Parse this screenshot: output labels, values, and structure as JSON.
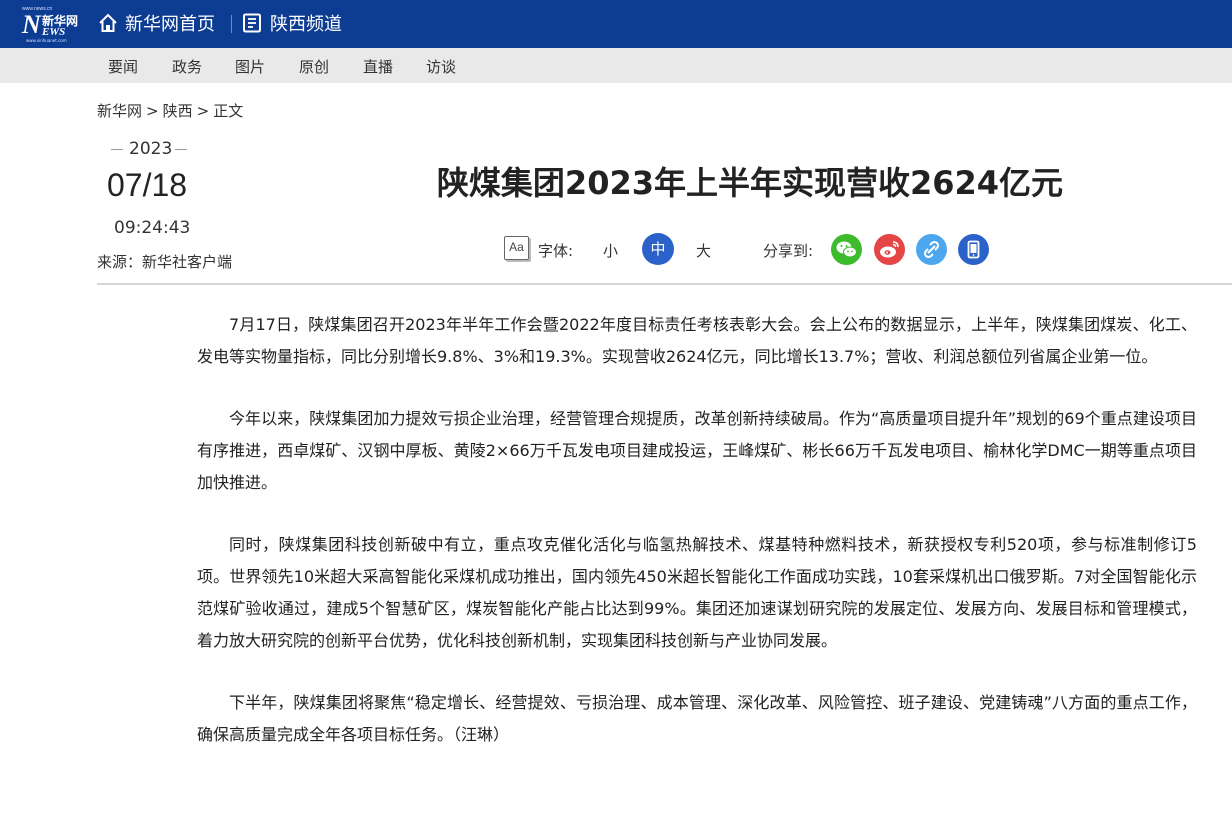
{
  "header": {
    "logo": {
      "small_text": "www.news.cn",
      "big_letter": "N",
      "cn_text": "新华网",
      "ews_text": "EWS",
      "foot_text": "www.xinhuanet.com"
    },
    "home_link": "新华网首页",
    "channel_link": "陕西频道"
  },
  "menu": {
    "items": [
      "要闻",
      "政务",
      "图片",
      "原创",
      "直播",
      "访谈"
    ]
  },
  "breadcrumb": {
    "items": [
      "新华网",
      "陕西",
      "正文"
    ],
    "separator": ">"
  },
  "meta": {
    "year": "2023",
    "date": "07/18",
    "time": "09:24:43",
    "source": "来源：新华社客户端"
  },
  "article": {
    "title": "陕煤集团2023年上半年实现营收2624亿元",
    "paragraphs": [
      "7月17日，陕煤集团召开2023年半年工作会暨2022年度目标责任考核表彰大会。会上公布的数据显示，上半年，陕煤集团煤炭、化工、发电等实物量指标，同比分别增长9.8%、3%和19.3%。实现营收2624亿元，同比增长13.7%；营收、利润总额位列省属企业第一位。",
      "今年以来，陕煤集团加力提效亏损企业治理，经营管理合规提质，改革创新持续破局。作为“高质量项目提升年”规划的69个重点建设项目有序推进，西卓煤矿、汉钢中厚板、黄陵2×66万千瓦发电项目建成投运，王峰煤矿、彬长66万千瓦发电项目、榆林化学DMC一期等重点项目加快推进。",
      "同时，陕煤集团科技创新破中有立，重点攻克催化活化与临氢热解技术、煤基特种燃料技术，新获授权专利520项，参与标准制修订5项。世界领先10米超大采高智能化采煤机成功推出，国内领先450米超长智能化工作面成功实践，10套采煤机出口俄罗斯。7对全国智能化示范煤矿验收通过，建成5个智慧矿区，煤炭智能化产能占比达到99%。集团还加速谋划研究院的发展定位、发展方向、发展目标和管理模式，着力放大研究院的创新平台优势，优化科技创新机制，实现集团科技创新与产业协同发展。",
      "下半年，陕煤集团将聚焦“稳定增长、经营提效、亏损治理、成本管理、深化改革、风险管控、班子建设、党建铸魂”八方面的重点工作，确保高质量完成全年各项目标任务。（汪琳）"
    ]
  },
  "tools": {
    "font_icon_text": "Aa",
    "font_label": "字体:",
    "font_small": "小",
    "font_medium": "中",
    "font_large": "大",
    "share_label": "分享到:",
    "share_icons": [
      "wechat-icon",
      "weibo-icon",
      "link-icon",
      "mobile-icon"
    ]
  },
  "colors": {
    "topbar": "#0d3c93",
    "menubar": "#e9e9e9",
    "accent": "#2b62c9",
    "wechat": "#3dbb2c",
    "weibo": "#e64545",
    "link": "#4da7ee"
  }
}
